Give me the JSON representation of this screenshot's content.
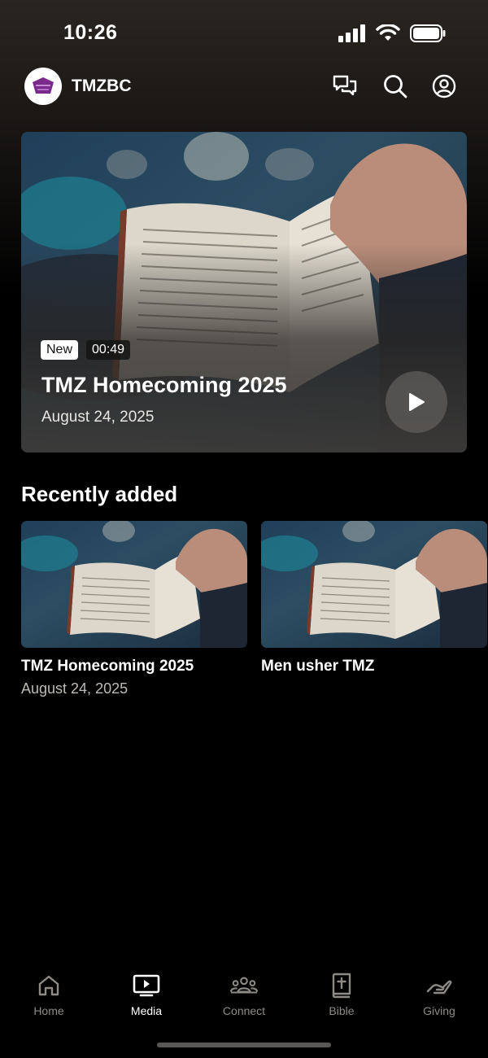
{
  "status_bar": {
    "time": "10:26"
  },
  "header": {
    "app_name": "TMZBC"
  },
  "hero": {
    "badge_new": "New",
    "duration": "00:49",
    "title": "TMZ Homecoming 2025",
    "date": "August 24, 2025"
  },
  "recent": {
    "heading": "Recently added",
    "items": [
      {
        "title": "TMZ Homecoming 2025",
        "date": "August 24, 2025"
      },
      {
        "title": "Men usher TMZ",
        "date": ""
      }
    ]
  },
  "nav": {
    "items": [
      {
        "label": "Home",
        "icon": "home-icon"
      },
      {
        "label": "Media",
        "icon": "media-icon",
        "active": true
      },
      {
        "label": "Connect",
        "icon": "people-icon"
      },
      {
        "label": "Bible",
        "icon": "bible-icon"
      },
      {
        "label": "Giving",
        "icon": "giving-icon"
      }
    ]
  },
  "colors": {
    "background": "#000000",
    "inactive": "#8d8a86",
    "active": "#ffffff"
  }
}
